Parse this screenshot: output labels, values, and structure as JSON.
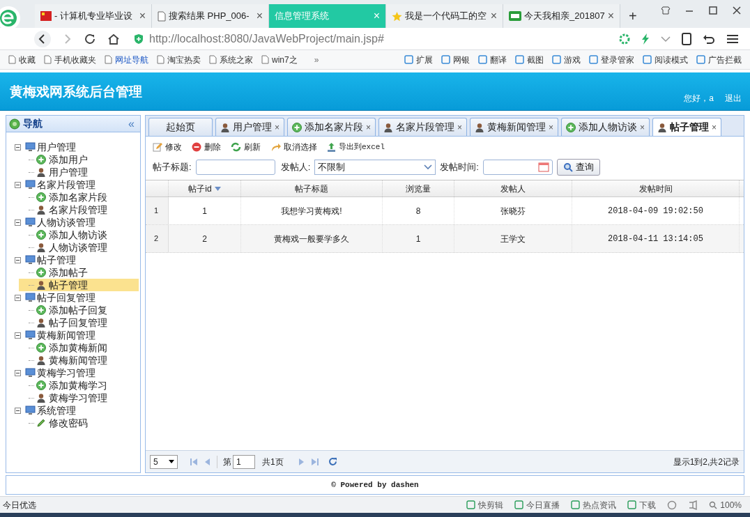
{
  "browser": {
    "tabs": [
      {
        "title": "- 计算机专业毕业设",
        "selected": false,
        "kind": "flag",
        "close": "×"
      },
      {
        "title": "搜索结果 PHP_006-",
        "selected": false,
        "kind": "page",
        "close": "×"
      },
      {
        "title": "信息管理系统",
        "selected": true,
        "kind": "none",
        "close": "×"
      },
      {
        "title": "我是一个代码工的空",
        "selected": false,
        "kind": "star",
        "close": "×"
      },
      {
        "title": "今天我相亲_201807",
        "selected": false,
        "kind": "video",
        "close": "×"
      }
    ],
    "new_tab": "+",
    "address": "http://localhost:8080/JavaWebProject/main.jsp#",
    "bookmarks": [
      "收藏",
      "手机收藏夹",
      "网址导航",
      "淘宝热卖",
      "系统之家",
      "win7之"
    ],
    "more": "»",
    "extensions": [
      "扩展",
      "网银",
      "翻译",
      "截图",
      "游戏",
      "登录管家",
      "阅读模式",
      "广告拦截"
    ]
  },
  "app": {
    "title": "黄梅戏网系统后台管理",
    "greeting": "您好，a",
    "logout": "退出"
  },
  "nav": {
    "title": "导航",
    "collapse": "«",
    "tree": [
      {
        "label": "用户管理",
        "expanded": true,
        "children": [
          {
            "label": "添加用户",
            "kind": "add",
            "selected": false
          },
          {
            "label": "用户管理",
            "kind": "user",
            "selected": false
          }
        ]
      },
      {
        "label": "名家片段管理",
        "expanded": true,
        "children": [
          {
            "label": "添加名家片段",
            "kind": "add",
            "selected": false
          },
          {
            "label": "名家片段管理",
            "kind": "user",
            "selected": false
          }
        ]
      },
      {
        "label": "人物访谈管理",
        "expanded": true,
        "children": [
          {
            "label": "添加人物访谈",
            "kind": "add",
            "selected": false
          },
          {
            "label": "人物访谈管理",
            "kind": "user",
            "selected": false
          }
        ]
      },
      {
        "label": "帖子管理",
        "expanded": true,
        "children": [
          {
            "label": "添加帖子",
            "kind": "add",
            "selected": false
          },
          {
            "label": "帖子管理",
            "kind": "user",
            "selected": true
          }
        ]
      },
      {
        "label": "帖子回复管理",
        "expanded": true,
        "children": [
          {
            "label": "添加帖子回复",
            "kind": "add",
            "selected": false
          },
          {
            "label": "帖子回复管理",
            "kind": "user",
            "selected": false
          }
        ]
      },
      {
        "label": "黄梅新闻管理",
        "expanded": true,
        "children": [
          {
            "label": "添加黄梅新闻",
            "kind": "add",
            "selected": false
          },
          {
            "label": "黄梅新闻管理",
            "kind": "user",
            "selected": false
          }
        ]
      },
      {
        "label": "黄梅学习管理",
        "expanded": true,
        "children": [
          {
            "label": "添加黄梅学习",
            "kind": "add",
            "selected": false
          },
          {
            "label": "黄梅学习管理",
            "kind": "user",
            "selected": false
          }
        ]
      },
      {
        "label": "系统管理",
        "expanded": true,
        "children": [
          {
            "label": "修改密码",
            "kind": "pencil",
            "selected": false
          }
        ]
      }
    ]
  },
  "tabs": [
    {
      "label": "起始页",
      "kind": "none",
      "selected": false
    },
    {
      "label": "用户管理",
      "kind": "user",
      "selected": false,
      "close": "×"
    },
    {
      "label": "添加名家片段",
      "kind": "add",
      "selected": false,
      "close": "×"
    },
    {
      "label": "名家片段管理",
      "kind": "user",
      "selected": false,
      "close": "×"
    },
    {
      "label": "黄梅新闻管理",
      "kind": "user",
      "selected": false,
      "close": "×"
    },
    {
      "label": "添加人物访谈",
      "kind": "add",
      "selected": false,
      "close": "×"
    },
    {
      "label": "帖子管理",
      "kind": "user",
      "selected": true,
      "close": "×"
    }
  ],
  "toolbar": [
    {
      "label": "修改",
      "kind": "edit"
    },
    {
      "label": "删除",
      "kind": "delete"
    },
    {
      "label": "刷新",
      "kind": "refresh"
    },
    {
      "label": "取消选择",
      "kind": "undo"
    },
    {
      "label": "导出到excel",
      "kind": "export"
    }
  ],
  "filters": {
    "title_label": "帖子标题:",
    "poster_label": "发帖人:",
    "poster_value": "不限制",
    "time_label": "发帖时间:",
    "search_button": "查询"
  },
  "table": {
    "columns": [
      {
        "label": "帖子id",
        "sorted": true
      },
      {
        "label": "帖子标题",
        "sorted": false
      },
      {
        "label": "浏览量",
        "sorted": false
      },
      {
        "label": "发帖人",
        "sorted": false
      },
      {
        "label": "发帖时间",
        "sorted": false
      }
    ],
    "rows": [
      {
        "number": "1",
        "cells": [
          "1",
          "我想学习黄梅戏!",
          "8",
          "张晓芬",
          "2018-04-09 19:02:50"
        ]
      },
      {
        "number": "2",
        "cells": [
          "2",
          "黄梅戏一般要学多久",
          "1",
          "王学文",
          "2018-04-11 13:14:05"
        ]
      }
    ]
  },
  "pager": {
    "page_size": "5",
    "page_prefix": "第",
    "page": "1",
    "page_total": "共1页",
    "summary": "显示1到2,共2记录"
  },
  "footer": "© Powered by dashen",
  "status_bar": {
    "left": "今日优选",
    "items": [
      "快剪辑",
      "今日直播",
      "热点资讯",
      "下载"
    ],
    "zoom": "100%"
  }
}
